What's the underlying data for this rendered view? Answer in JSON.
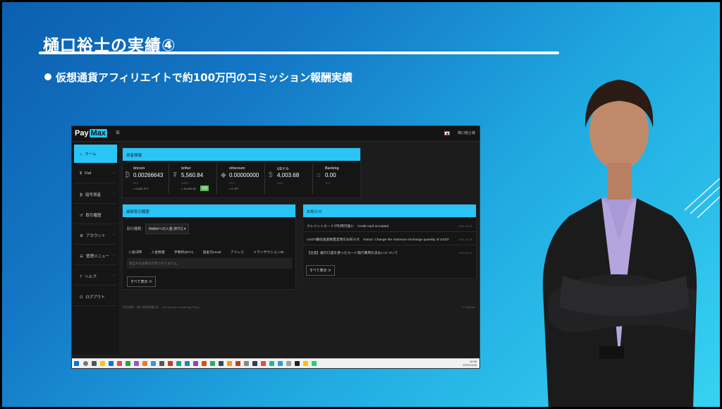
{
  "slide": {
    "title": "樋口裕士の実績④",
    "bullet": "仮想通貨アフィリエイトで約100万円のコミッション報酬実績"
  },
  "app": {
    "logo_pre": "Pay",
    "logo_max": "Max",
    "user_menu": "樋口裕士様"
  },
  "sidebar": {
    "items": [
      {
        "label": "ホーム",
        "icon": "home-icon"
      },
      {
        "label": "Fiat",
        "icon": "dollar-icon"
      },
      {
        "label": "暗号資産",
        "icon": "bitcoin-icon"
      },
      {
        "label": "取引履歴",
        "icon": "history-icon"
      },
      {
        "label": "アカウント",
        "icon": "gear-icon"
      },
      {
        "label": "管理メニュー",
        "icon": "list-icon"
      },
      {
        "label": "ヘルプ",
        "icon": "help-icon"
      },
      {
        "label": "ログアウト",
        "icon": "logout-icon"
      }
    ]
  },
  "assets_panel": {
    "heading": "資産情報",
    "assets": [
      {
        "name": "bitcoin",
        "value": "0.00266643",
        "unit": "BTC",
        "change": "≈ 5,005 JPY"
      },
      {
        "name": "tether",
        "value": "5,560.84",
        "unit": "USDT",
        "change": "≈ 15,394,83",
        "badge": "交換"
      },
      {
        "name": "ethereum",
        "value": "0.00000000",
        "unit": "ETH",
        "change": "≈ 0 JPY"
      },
      {
        "name": "USドル",
        "value": "4,003.68",
        "unit": "USD",
        "change": ""
      },
      {
        "name": "Banking",
        "value": "0.00",
        "unit": "JPY",
        "change": ""
      }
    ]
  },
  "trade_panel": {
    "heading": "最新取引履歴",
    "filter_label": "取引種類：",
    "filter_value": "Walletへの入金 (BTC)",
    "columns": [
      "入金日時",
      "入金数量",
      "手数料(BTC)",
      "送金元email",
      "アドレス",
      "トランザクションID"
    ],
    "empty_text": "該当するお取引が見つかりません。",
    "show_all": "すべて表示 ≫"
  },
  "news_panel": {
    "heading": "お知らせ",
    "items": [
      {
        "text": "クレジットカードが利用可能に　Credit card accepted",
        "date": "2021.06.01"
      },
      {
        "text": "USDT最低送金数量変更のお知らせ　Notice: Change the minimum exchange quantity of USDT",
        "date": "2021.05.20"
      },
      {
        "text": "【注意】銀行口座を使ったカード発行費用の支払いについて",
        "date": "2020.12.21"
      }
    ],
    "show_all": "すべて表示 ≫"
  },
  "footer": {
    "links": "利用規約　個人情報保護方針　Anti Money Laundering Policy",
    "copyright": "© PayMax"
  },
  "taskbar": {
    "time": "10:26",
    "date": "2021/11/26"
  },
  "colors": {
    "accent": "#29c5f6",
    "panel": "#151515"
  }
}
